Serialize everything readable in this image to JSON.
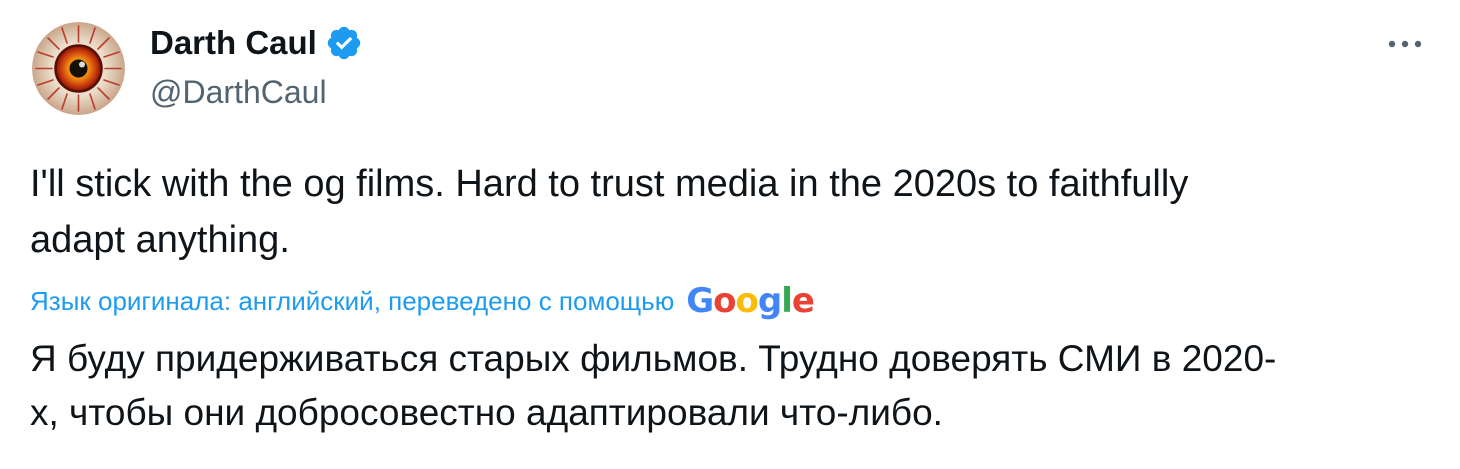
{
  "author": {
    "display_name": "Darth Caul",
    "handle": "@DarthCaul",
    "verified": true,
    "avatar_icon": "eye-avatar-icon"
  },
  "more_icon": "more-horizontal-icon",
  "tweet": {
    "text_line1": "I'll stick with the og films. Hard to trust media in the 2020s to faithfully",
    "text_line2": "adapt anything."
  },
  "translation": {
    "note": "Язык оригинала: английский, переведено с помощью",
    "provider": "Google",
    "text_line1": "Я буду придерживаться старых фильмов. Трудно доверять СМИ в 2020-",
    "text_line2": "х, чтобы они добросовестно адаптировали что-либо."
  },
  "colors": {
    "text_primary": "#0f1419",
    "text_secondary": "#536471",
    "link_blue": "#1d9bf0",
    "verified_blue": "#1d9bf0",
    "google_blue": "#4285f4",
    "google_red": "#ea4335",
    "google_yellow": "#fbbc05",
    "google_green": "#34a853"
  }
}
